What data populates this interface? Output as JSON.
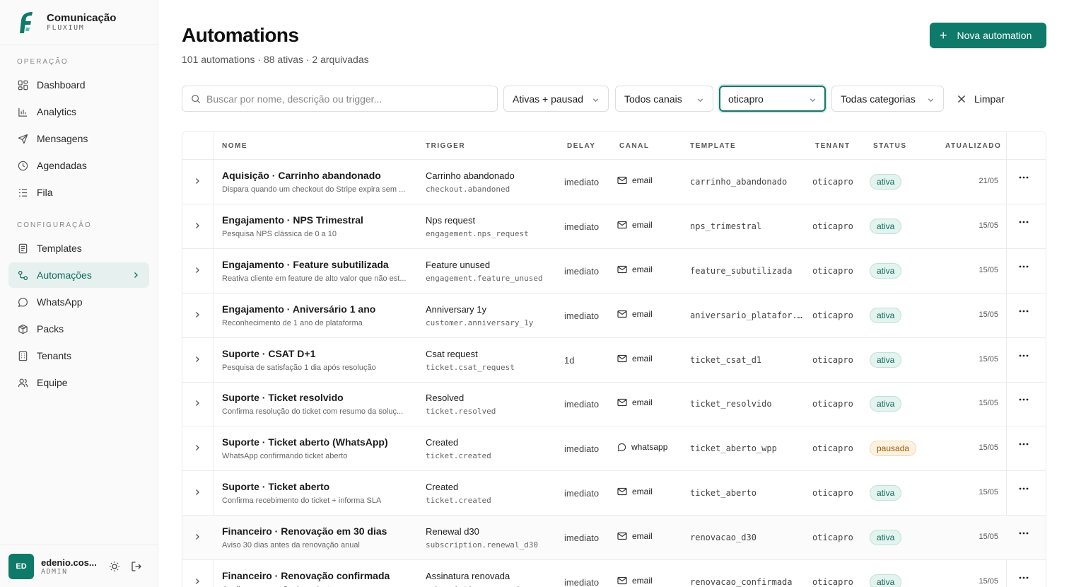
{
  "brand": {
    "name": "Comunicação",
    "sub": "FLUXIUM"
  },
  "sidebar": {
    "sections": [
      {
        "title": "OPERAÇÃO",
        "items": [
          {
            "label": "Dashboard",
            "icon": "dashboard-icon"
          },
          {
            "label": "Analytics",
            "icon": "bar-chart-icon"
          },
          {
            "label": "Mensagens",
            "icon": "send-icon"
          },
          {
            "label": "Agendadas",
            "icon": "clock-icon"
          },
          {
            "label": "Fila",
            "icon": "list-icon"
          }
        ]
      },
      {
        "title": "CONFIGURAÇÃO",
        "items": [
          {
            "label": "Templates",
            "icon": "document-icon"
          },
          {
            "label": "Automações",
            "icon": "workflow-icon",
            "active": true
          },
          {
            "label": "WhatsApp",
            "icon": "chat-bubble-icon"
          },
          {
            "label": "Packs",
            "icon": "package-icon"
          },
          {
            "label": "Tenants",
            "icon": "building-icon"
          },
          {
            "label": "Equipe",
            "icon": "users-icon"
          }
        ]
      }
    ]
  },
  "user": {
    "initials": "ED",
    "name": "edenio.cos...",
    "role": "ADMIN"
  },
  "page": {
    "title": "Automations",
    "subtitle": "101 automations · 88 ativas · 2 arquivadas",
    "new_button": "Nova automation"
  },
  "filters": {
    "search_placeholder": "Buscar por nome, descrição ou trigger...",
    "status": "Ativas + pausad",
    "channel": "Todos canais",
    "tenant": "oticapro",
    "category": "Todas categorias",
    "clear": "Limpar"
  },
  "table": {
    "columns": [
      "NOME",
      "TRIGGER",
      "DELAY",
      "CANAL",
      "TEMPLATE",
      "TENANT",
      "STATUS",
      "ATUALIZADO"
    ],
    "rows": [
      {
        "name": "Aquisição · Carrinho abandonado",
        "desc": "Dispara quando um checkout do Stripe expira sem ...",
        "trigger": "Carrinho abandonado",
        "event": "checkout.abandoned",
        "delay": "imediato",
        "channel": "email",
        "template": "carrinho_abandonado",
        "tenant": "oticapro",
        "status": "ativa",
        "updated": "21/05"
      },
      {
        "name": "Engajamento · NPS Trimestral",
        "desc": "Pesquisa NPS clássica de 0 a 10",
        "trigger": "Nps request",
        "event": "engagement.nps_request",
        "delay": "imediato",
        "channel": "email",
        "template": "nps_trimestral",
        "tenant": "oticapro",
        "status": "ativa",
        "updated": "15/05"
      },
      {
        "name": "Engajamento · Feature subutilizada",
        "desc": "Reativa cliente em feature de alto valor que não est...",
        "trigger": "Feature unused",
        "event": "engagement.feature_unused",
        "delay": "imediato",
        "channel": "email",
        "template": "feature_subutilizada",
        "tenant": "oticapro",
        "status": "ativa",
        "updated": "15/05"
      },
      {
        "name": "Engajamento · Aniversário 1 ano",
        "desc": "Reconhecimento de 1 ano de plataforma",
        "trigger": "Anniversary 1y",
        "event": "customer.anniversary_1y",
        "delay": "imediato",
        "channel": "email",
        "template": "aniversario_platafor...",
        "tenant": "oticapro",
        "status": "ativa",
        "updated": "15/05"
      },
      {
        "name": "Suporte · CSAT D+1",
        "desc": "Pesquisa de satisfação 1 dia após resolução",
        "trigger": "Csat request",
        "event": "ticket.csat_request",
        "delay": "1d",
        "channel": "email",
        "template": "ticket_csat_d1",
        "tenant": "oticapro",
        "status": "ativa",
        "updated": "15/05"
      },
      {
        "name": "Suporte · Ticket resolvido",
        "desc": "Confirma resolução do ticket com resumo da soluç...",
        "trigger": "Resolved",
        "event": "ticket.resolved",
        "delay": "imediato",
        "channel": "email",
        "template": "ticket_resolvido",
        "tenant": "oticapro",
        "status": "ativa",
        "updated": "15/05"
      },
      {
        "name": "Suporte · Ticket aberto (WhatsApp)",
        "desc": "WhatsApp confirmando ticket aberto",
        "trigger": "Created",
        "event": "ticket.created",
        "delay": "imediato",
        "channel": "whatsapp",
        "template": "ticket_aberto_wpp",
        "tenant": "oticapro",
        "status": "pausada",
        "updated": "15/05"
      },
      {
        "name": "Suporte · Ticket aberto",
        "desc": "Confirma recebimento do ticket + informa SLA",
        "trigger": "Created",
        "event": "ticket.created",
        "delay": "imediato",
        "channel": "email",
        "template": "ticket_aberto",
        "tenant": "oticapro",
        "status": "ativa",
        "updated": "15/05"
      },
      {
        "name": "Financeiro · Renovação em 30 dias",
        "desc": "Aviso 30 dias antes da renovação anual",
        "trigger": "Renewal d30",
        "event": "subscription.renewal_d30",
        "delay": "imediato",
        "channel": "email",
        "template": "renovacao_d30",
        "tenant": "oticapro",
        "status": "ativa",
        "updated": "15/05"
      },
      {
        "name": "Financeiro · Renovação confirmada",
        "desc": "Confirma renovação da assinatura",
        "trigger": "Assinatura renovada",
        "event": "subscription.renewed",
        "delay": "imediato",
        "channel": "email",
        "template": "renovacao_confirmada",
        "tenant": "oticapro",
        "status": "ativa",
        "updated": "15/05"
      }
    ]
  },
  "colors": {
    "accent": "#0f7a6a",
    "active_bg": "#e6f1ef",
    "ativa": "#e3f3ee",
    "pausada": "#fdf1df"
  }
}
